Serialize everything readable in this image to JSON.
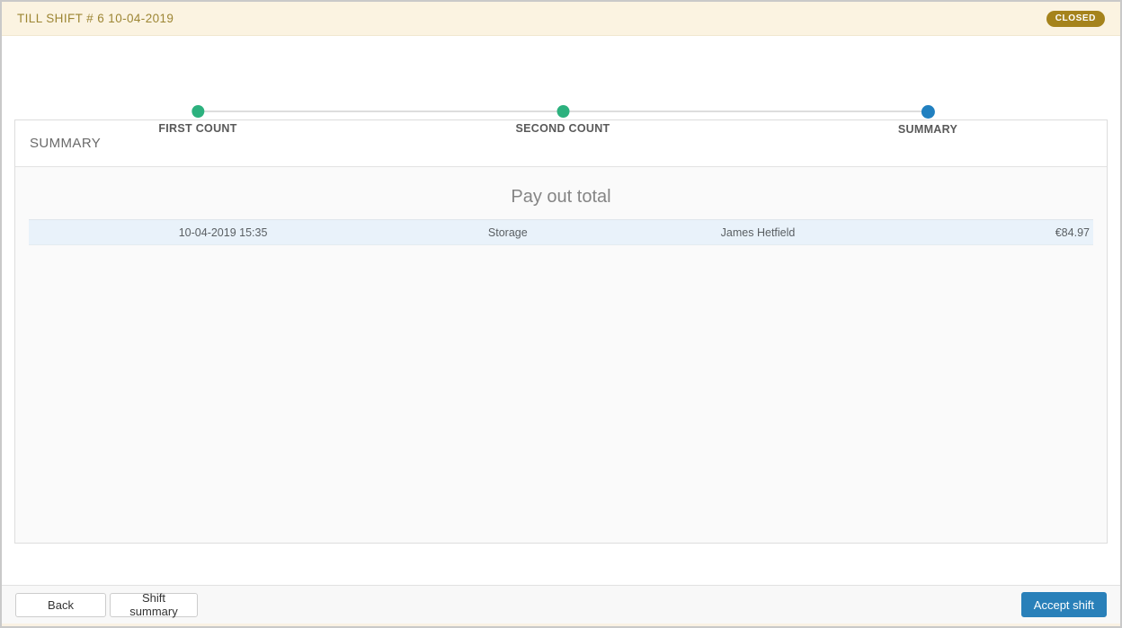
{
  "header": {
    "title": "TILL SHIFT # 6 10-04-2019",
    "status_badge": "CLOSED"
  },
  "stepper": {
    "steps": [
      {
        "label": "FIRST COUNT",
        "state": "complete"
      },
      {
        "label": "SECOND COUNT",
        "state": "complete"
      },
      {
        "label": "SUMMARY",
        "state": "active"
      }
    ]
  },
  "panel": {
    "title": "SUMMARY",
    "section_title": "Pay out total",
    "rows": [
      {
        "datetime": "10-04-2019 15:35",
        "category": "Storage",
        "employee": "James Hetfield",
        "amount": "€84.97"
      }
    ]
  },
  "footer": {
    "back_label": "Back",
    "shift_summary_label": "Shift summary",
    "accept_label": "Accept shift"
  },
  "colors": {
    "topbar_bg": "#fbf3e1",
    "topbar_text": "#9d8634",
    "badge_bg": "#a5831c",
    "step_complete_dot": "#2cb17e",
    "step_active_dot": "#2180c0",
    "row_bg": "#e9f2fa",
    "accept_button_bg": "#2980b9"
  }
}
